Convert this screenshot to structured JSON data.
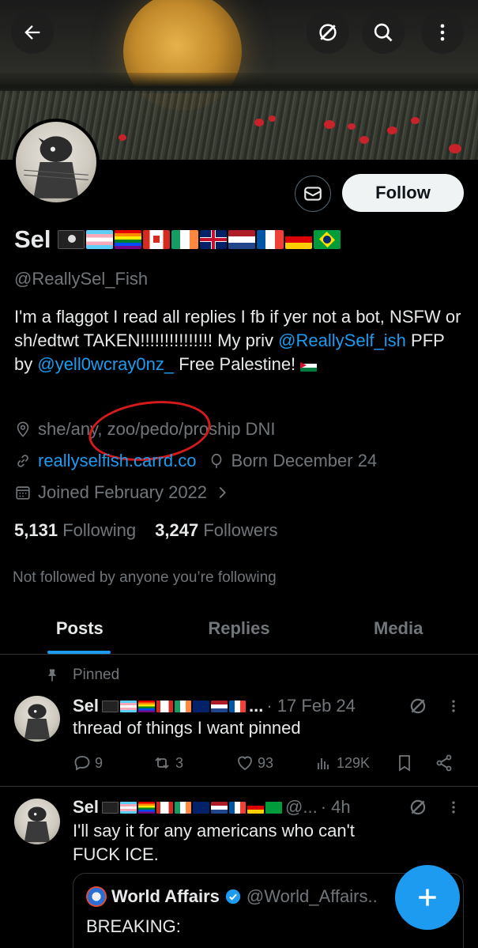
{
  "profile": {
    "name": "Sel",
    "handle": "@ReallySel_Fish",
    "follow_label": "Follow",
    "bio_part1": "I'm a flaggot I read all replies I fb if yer not a bot, NSFW or sh/edtwt TAKEN!!!!!!!!!!!!!!! My priv ",
    "bio_link1": "@ReallySelf_ish",
    "bio_part2": " PFP by ",
    "bio_link2": "@yell0wcray0nz_",
    "bio_part3": " Free Palestine!",
    "pronouns": "she/any, zoo/pedo/proship DNI",
    "website": "reallyselfish.carrd.co",
    "born": "Born December 24",
    "joined": "Joined February 2022",
    "following_count": "5,131",
    "following_label": "Following",
    "followers_count": "3,247",
    "followers_label": "Followers",
    "not_followed": "Not followed by anyone you’re following"
  },
  "tabs": [
    {
      "label": "Posts"
    },
    {
      "label": "Replies"
    },
    {
      "label": "Media"
    }
  ],
  "pinned_label": "Pinned",
  "tweets": [
    {
      "name": "Sel",
      "name_suffix": "...",
      "meta": "· 17 Feb 24",
      "text": "thread of things I want pinned",
      "replies": "9",
      "reposts": "3",
      "likes": "93",
      "views": "129K"
    },
    {
      "name": "Sel",
      "name_suffix": "@...",
      "meta": "· 4h",
      "text_line1": "I'll say it for any americans who can't",
      "text_line2": "FUCK ICE."
    }
  ],
  "quote": {
    "name": "World Affairs",
    "handle": "@World_Affairs..",
    "text": "BREAKING:"
  },
  "icons": {
    "back": "back-arrow-icon",
    "grok": "grok-icon",
    "search": "search-icon",
    "more": "more-vertical-icon",
    "message": "envelope-icon",
    "location": "location-pin-icon",
    "link": "link-icon",
    "birthday": "balloon-icon",
    "calendar": "calendar-icon",
    "pin": "pin-icon",
    "reply": "reply-icon",
    "repost": "repost-icon",
    "like": "heart-icon",
    "views": "views-icon",
    "bookmark": "bookmark-icon",
    "share": "share-icon",
    "verified": "verified-badge-icon",
    "compose": "compose-plus-icon"
  },
  "colors": {
    "accent": "#1d9bf0",
    "background": "#000000",
    "text": "#e7e9ea",
    "muted": "#71767b",
    "annotation": "#d41a1a"
  }
}
